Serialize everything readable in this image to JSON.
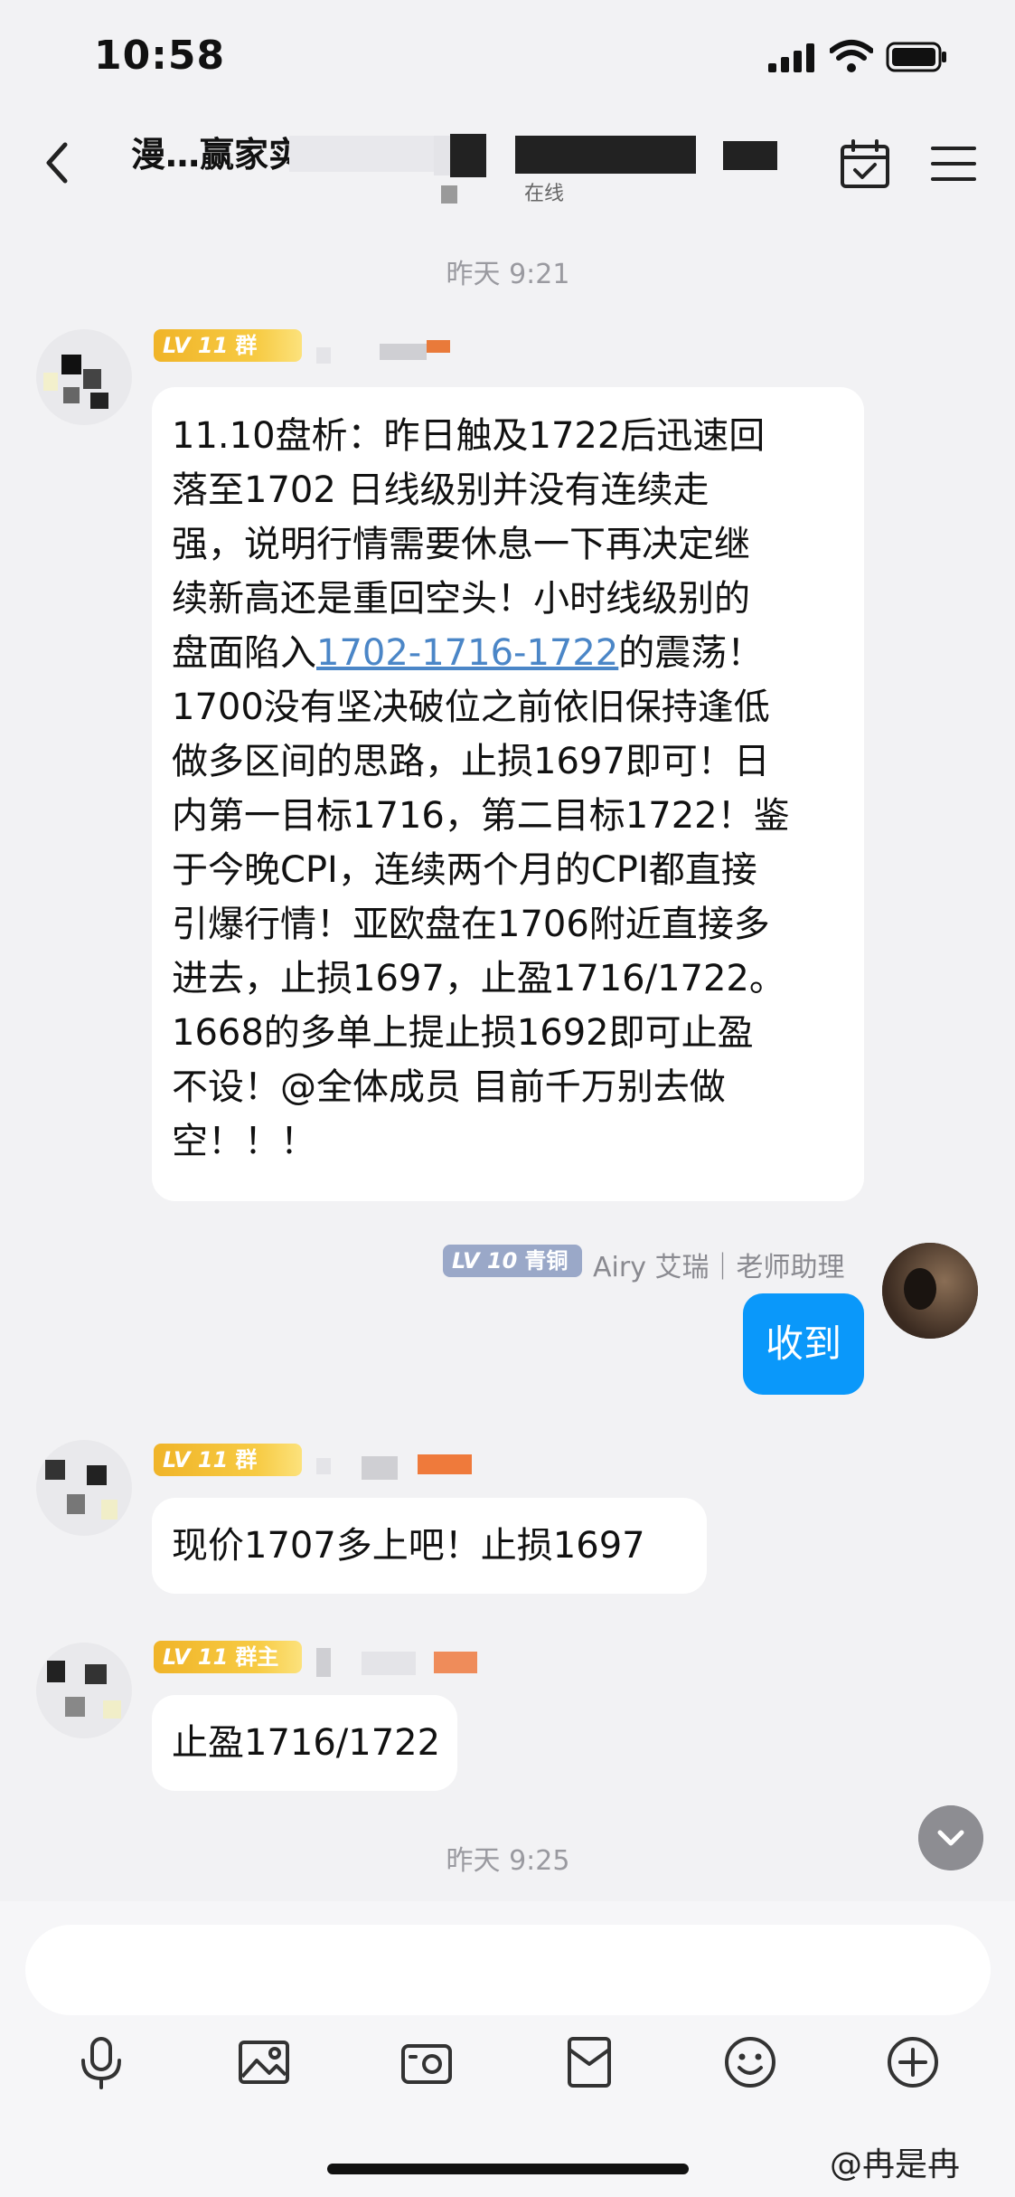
{
  "status_bar": {
    "time": "10:58"
  },
  "header": {
    "title": "漫…赢家实战研…",
    "subtitle": "在线"
  },
  "timestamps": [
    "昨天 9:21",
    "昨天 9:25"
  ],
  "messages": [
    {
      "badge_level": "LV 11",
      "badge_title": "群",
      "lines": [
        "11.10盘析：昨日触及1722后迅速回",
        "落至1702 日线级别并没有连续走",
        "强，说明行情需要休息一下再决定继",
        "续新高还是重回空头！小时线级别的",
        "1700没有坚决破位之前依旧保持逢低",
        "做多区间的思路，止损1697即可！日",
        "内第一目标1716，第二目标1722！鉴",
        "于今晚CPI，连续两个月的CPI都直接",
        "引爆行情！亚欧盘在1706附近直接多",
        "进去，止损1697，止盈1716/1722。",
        "1668的多单上提止损1692即可止盈",
        "不设！@全体成员  目前千万别去做",
        "空！！！"
      ],
      "line5_prefix": "盘面陷入",
      "line5_link": "1702-1716-1722",
      "line5_suffix": "的震荡！"
    },
    {
      "badge_level": "LV 10",
      "badge_title": "青铜",
      "sender": "Airy 艾瑞｜老师助理",
      "text": "收到"
    },
    {
      "badge_level": "LV 11",
      "badge_title": "群",
      "text": "现价1707多上吧！止损1697"
    },
    {
      "badge_level": "LV 11",
      "badge_title": "群主",
      "text": "止盈1716/1722"
    }
  ],
  "composer": {
    "placeholder": ""
  },
  "toolbar_icons": [
    "microphone-icon",
    "image-icon",
    "camera-icon",
    "red-packet-icon",
    "emoji-icon",
    "plus-icon"
  ],
  "watermark": "冉是冉",
  "colors": {
    "accent_blue": "#0a98fa",
    "link": "#4b86c7",
    "badge_gold": "#f7cb44",
    "badge_blue": "#9aa8c8"
  }
}
